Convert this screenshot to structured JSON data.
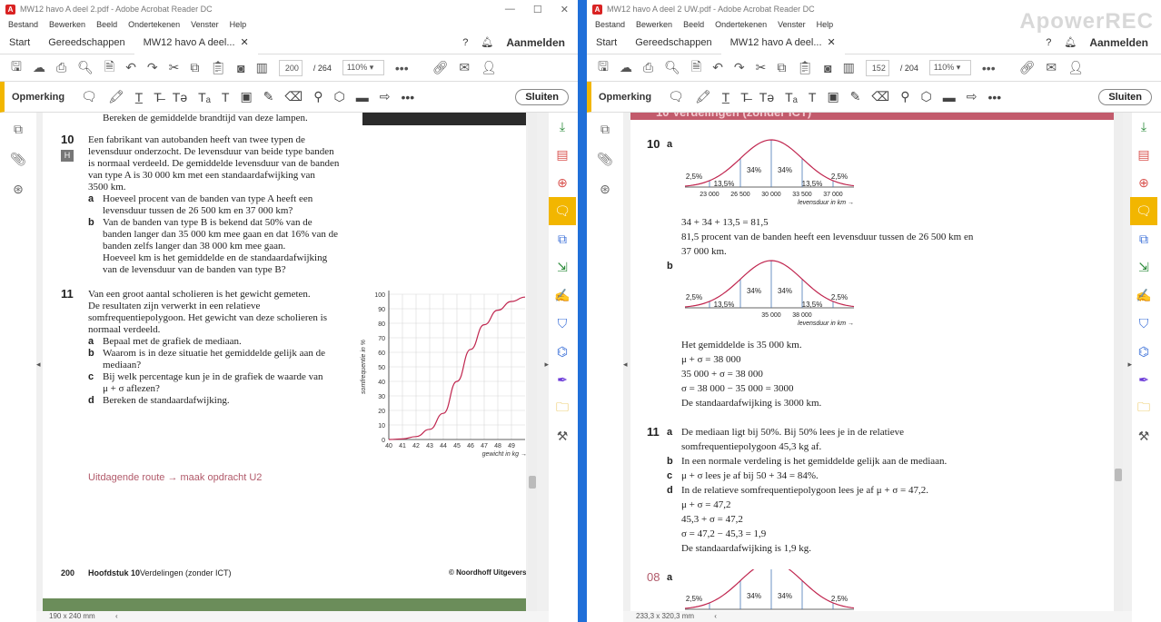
{
  "left": {
    "title": "MW12 havo A deel 2.pdf - Adobe Acrobat Reader DC",
    "menu": [
      "Bestand",
      "Bewerken",
      "Beeld",
      "Ondertekenen",
      "Venster",
      "Help"
    ],
    "tabs": {
      "start": "Start",
      "tools": "Gereedschappen",
      "doc": "MW12 havo A deel..."
    },
    "signin": "Aanmelden",
    "page_current": "200",
    "page_total": "/ 264",
    "zoom": "110%",
    "comment_label": "Opmerking",
    "close_label": "Sluiten",
    "status_size": "190 x 240 mm",
    "content": {
      "top_line": "Bereken de gemiddelde brandtijd van deze lampen.",
      "q10_num": "10",
      "q10_badge": "H",
      "q10_lines": [
        "Een fabrikant van autobanden heeft van twee typen de",
        "levensduur onderzocht. De levensduur van beide type banden",
        "is normaal verdeeld. De gemiddelde levensduur van de banden",
        "van type A is 30 000 km met een standaardafwijking van",
        "3500 km."
      ],
      "q10a_lines": [
        "Hoeveel procent van de banden van type A heeft een",
        "levensduur tussen de 26 500 km en 37 000 km?"
      ],
      "q10b_lines": [
        "Van de banden van type B is bekend dat 50% van de",
        "banden langer dan 35 000 km mee gaan en dat 16% van de",
        "banden zelfs langer dan 38 000 km mee gaan.",
        "Hoeveel km is het gemiddelde en de standaardafwijking",
        "van de levensduur van de banden van type B?"
      ],
      "q11_num": "11",
      "q11_lines": [
        "Van een groot aantal scholieren is het gewicht gemeten.",
        "De resultaten zijn verwerkt in een relatieve",
        "somfrequentiepolygoon. Het gewicht van deze scholieren is",
        "normaal verdeeld."
      ],
      "q11a": "Bepaal met de grafiek de mediaan.",
      "q11b_lines": [
        "Waarom is in deze situatie het gemiddelde gelijk aan de",
        "mediaan?"
      ],
      "q11c_lines": [
        "Bij welk percentage kun je in de grafiek de waarde van",
        "μ + σ aflezen?"
      ],
      "q11d": "Bereken de standaardafwijking.",
      "letters": [
        "a",
        "b",
        "c",
        "d"
      ],
      "route": "Uitdagende route → maak opdracht U2",
      "footer_num": "200",
      "footer_chapter": "Hoofdstuk 10",
      "footer_title": "Verdelingen (zonder ICT)",
      "footer_pub": "© Noordhoff Uitgevers"
    }
  },
  "right": {
    "title": "MW12 havo A deel 2 UW.pdf - Adobe Acrobat Reader DC",
    "menu": [
      "Bestand",
      "Bewerken",
      "Beeld",
      "Ondertekenen",
      "Venster",
      "Help"
    ],
    "tabs": {
      "start": "Start",
      "tools": "Gereedschappen",
      "doc": "MW12 havo A deel..."
    },
    "signin": "Aanmelden",
    "page_current": "152",
    "page_total": "/ 204",
    "zoom": "110%",
    "comment_label": "Opmerking",
    "close_label": "Sluiten",
    "status_size": "233,3 x 320,3 mm",
    "watermark": "ApowerREC",
    "content": {
      "header_band": "10 Verdelingen (zonder ICT)",
      "a10_num": "10",
      "a10_a": "a",
      "a10_b": "b",
      "a10a_lines": [
        "34 + 34 + 13,5 = 81,5",
        "81,5 procent van de banden heeft een levensduur tussen de 26 500 km en",
        "37 000 km."
      ],
      "a10b_lines": [
        "Het gemiddelde is 35 000 km.",
        "μ + σ = 38 000",
        "35 000 + σ = 38 000",
        "σ = 38 000 − 35 000 = 3000",
        "De standaardafwijking is 3000 km."
      ],
      "a11_num": "11",
      "a11a_lines": [
        "De mediaan ligt bij 50%. Bij 50% lees je in de relatieve",
        "somfrequentiepolygoon 45,3 kg af."
      ],
      "a11b": "In een normale verdeling is het gemiddelde gelijk aan de mediaan.",
      "a11c": "μ + σ  lees je af bij 50 + 34 = 84%.",
      "a11d_lines": [
        "In de relatieve somfrequentiepolygoon lees je af μ + σ = 47,2.",
        "μ + σ = 47,2",
        "45,3 + σ = 47,2",
        "σ = 47,2 − 45,3 = 1,9",
        "De standaardafwijking is 1,9 kg."
      ],
      "letters": [
        "a",
        "b",
        "c",
        "d"
      ],
      "a08_num": "08",
      "a08_a": "a"
    }
  },
  "chart_data": [
    {
      "type": "line",
      "xlabel": "gewicht in kg",
      "ylabel": "somfrequentie in %",
      "x_ticks": [
        "40",
        "41",
        "42",
        "43",
        "44",
        "45",
        "46",
        "47",
        "48",
        "49"
      ],
      "y_ticks": [
        "0",
        "10",
        "20",
        "30",
        "40",
        "50",
        "60",
        "70",
        "80",
        "90",
        "100"
      ],
      "xlim": [
        40,
        50
      ],
      "ylim": [
        0,
        100
      ],
      "x": [
        40,
        41,
        42,
        43,
        44,
        45,
        46,
        47,
        48,
        49,
        50
      ],
      "y": [
        0,
        0.4,
        2,
        7,
        18,
        40,
        62,
        79,
        89,
        95,
        98
      ],
      "grid": true
    },
    {
      "type": "area",
      "xlabel": "levensduur in km",
      "x_ticks": [
        "23 000",
        "26 500",
        "30 000",
        "33 500",
        "37 000"
      ],
      "percent_labels": [
        "2,5%",
        "13,5%",
        "34%",
        "34%",
        "13,5%",
        "2,5%"
      ]
    },
    {
      "type": "area",
      "xlabel": "levensduur in km",
      "x_ticks": [
        "35 000",
        "38 000"
      ],
      "percent_labels": [
        "2,5%",
        "13,5%",
        "34%",
        "34%",
        "13,5%",
        "2,5%"
      ]
    },
    {
      "type": "area",
      "percent_labels": [
        "2,5%",
        "34%",
        "34%",
        "2,5%"
      ]
    }
  ]
}
